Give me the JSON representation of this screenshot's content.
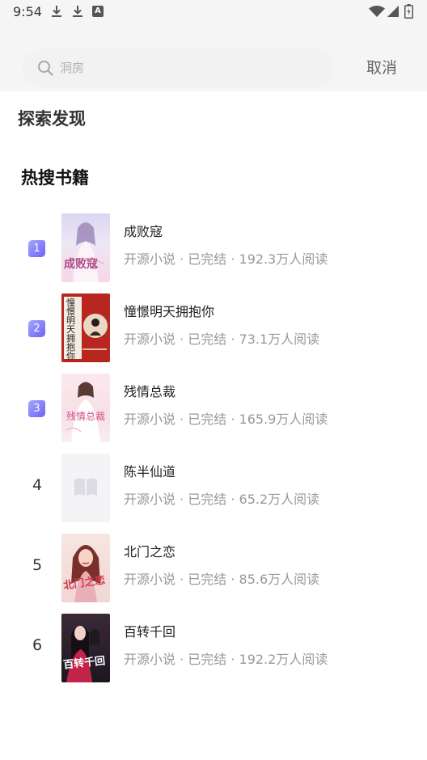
{
  "status_bar": {
    "time": "9:54",
    "icons": [
      "download-icon",
      "download-icon",
      "a-icon",
      "wifi-icon",
      "signal-icon",
      "battery-icon"
    ]
  },
  "search": {
    "placeholder": "洞房",
    "cancel_label": "取消",
    "icon": "search-icon"
  },
  "sections": {
    "explore_title": "探索发现",
    "hot_title": "热搜书籍"
  },
  "books": [
    {
      "rank": "1",
      "title": "成败寇",
      "meta": "开源小说 · 已完结 · 192.3万人阅读",
      "cover_text": "成败寇",
      "badge": true
    },
    {
      "rank": "2",
      "title": "憧憬明天拥抱你",
      "meta": "开源小说 · 已完结 · 73.1万人阅读",
      "cover_text": "憧憬明天拥抱你",
      "badge": true
    },
    {
      "rank": "3",
      "title": "残情总裁",
      "meta": "开源小说 · 已完结 · 165.9万人阅读",
      "cover_text": "残情总裁",
      "badge": true
    },
    {
      "rank": "4",
      "title": "陈半仙道",
      "meta": "开源小说 · 已完结 · 65.2万人阅读",
      "cover_text": "",
      "badge": false
    },
    {
      "rank": "5",
      "title": "北门之恋",
      "meta": "开源小说 · 已完结 · 85.6万人阅读",
      "cover_text": "北门之恋",
      "badge": false
    },
    {
      "rank": "6",
      "title": "百转千回",
      "meta": "开源小说 · 已完结 · 192.2万人阅读",
      "cover_text": "百转千回",
      "badge": false
    }
  ],
  "colors": {
    "badge_accent": "#7b74f7",
    "meta_text": "#999999",
    "top_background": "#f5f5f5"
  }
}
